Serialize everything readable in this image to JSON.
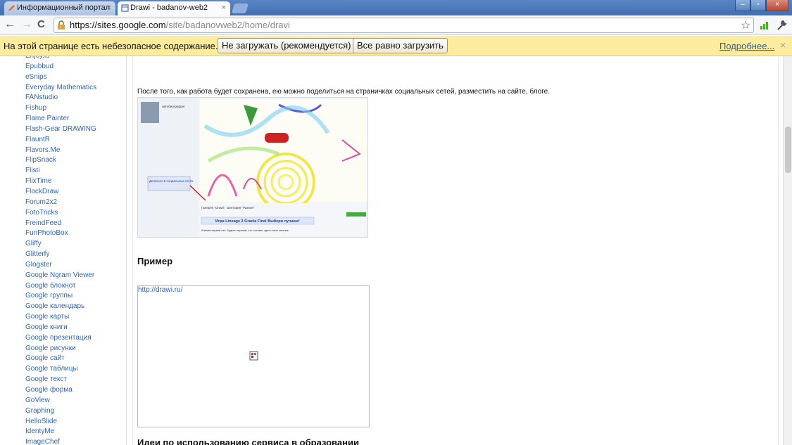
{
  "browser": {
    "tabs": [
      {
        "label": "Информационный портал",
        "close": "×"
      },
      {
        "label": "Drawi - badanov-web2",
        "close": "×"
      }
    ],
    "window_buttons": [
      "–",
      "▫",
      "×"
    ],
    "url_host": "https://sites.google.com",
    "url_path": "/site/badanovweb2/home/dravi",
    "nav": {
      "back": "←",
      "forward": "→",
      "reload": "C",
      "star": "☆",
      "wrench": "🔧"
    }
  },
  "infobar": {
    "message": "На этой странице есть небезопасное содержание.",
    "dont_load": "Не загружать (рекомендуется)",
    "load_anyway": "Все равно загрузить",
    "more": "Подробнее...",
    "close": "×"
  },
  "sidebar": {
    "items": [
      "Enjoy.is",
      "Epubbud",
      "eSnips",
      "Everyday Mathematics",
      "FANstudio",
      "Fishup",
      "Flame Painter",
      "Flash-Gear DRAWING",
      "FlauntR",
      "Flavors.Me",
      "FlipSnack",
      "Flisti",
      "FlixTime",
      "FlockDraw",
      "Forum2x2",
      "FotoTricks",
      "FreindFeed",
      "FunPhotoBox",
      "Gliffy",
      "Glitterfy",
      "Glogster",
      "Google Ngram Viewer",
      "Google блокнот",
      "Google группы",
      "Google календарь",
      "Google карты",
      "Google книги",
      "Google презентация",
      "Google рисунки",
      "Google сайт",
      "Google таблицы",
      "Google текст",
      "Google форма",
      "GoView",
      "Graphing",
      "HelloSlide",
      "IdentyMe",
      "ImageChef"
    ]
  },
  "content": {
    "paragraph": "После того, как работа будет сохранена, ею можно поделиться на страничках социальных сетей, разместить на сайте, блоге.",
    "screenshot_texts": {
      "author": "автобиография",
      "share_note": "Делиться в социальных сетях",
      "banner": "Игра Lineage 2 Gracia Final Выбери лучшее!",
      "gallery": "Галерея \"Drawi\", категория \"Разное\"",
      "comments": "Комментариев нет. Будьте первым, кто оставит здесь свое мнение."
    },
    "example_heading": "Пример",
    "embed_link": "http://drawi.ru/",
    "ideas_heading": "Идеи по использованию сервиса в образовании"
  }
}
